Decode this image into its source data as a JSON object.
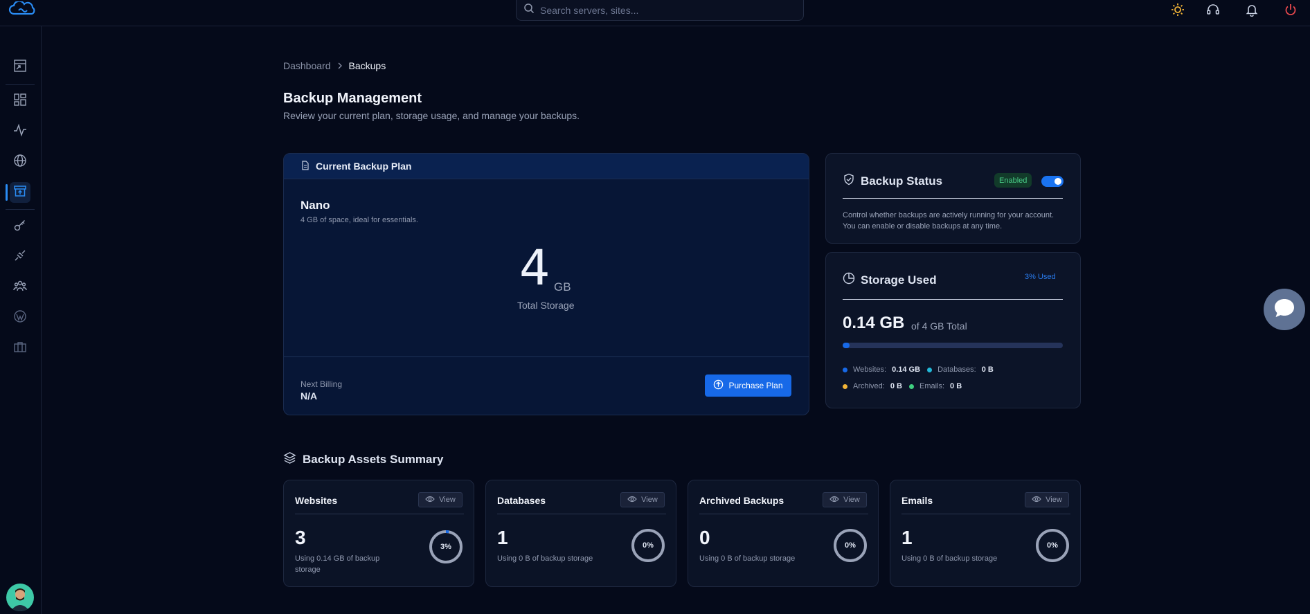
{
  "search": {
    "placeholder": "Search servers, sites..."
  },
  "breadcrumb": {
    "items": [
      "Dashboard",
      "Backups"
    ]
  },
  "page": {
    "title": "Backup Management",
    "subtitle": "Review your current plan, storage usage, and manage your backups."
  },
  "plan": {
    "header": "Current Backup Plan",
    "name": "Nano",
    "description": "4 GB of space, ideal for essentials.",
    "storage_value": "4",
    "storage_unit": "GB",
    "storage_label": "Total Storage",
    "billing_label": "Next Billing",
    "billing_value": "N/A",
    "purchase_label": "Purchase Plan"
  },
  "status": {
    "title": "Backup Status",
    "badge": "Enabled",
    "enabled": true,
    "description": "Control whether backups are actively running for your account. You can enable or disable backups at any time."
  },
  "storage": {
    "title": "Storage Used",
    "used_badge": "3% Used",
    "used_value": "0.14 GB",
    "of_total": "of 4 GB Total",
    "used_fraction": 0.03,
    "legend": [
      {
        "label": "Websites:",
        "value": "0.14 GB",
        "color": "#1769e8"
      },
      {
        "label": "Databases:",
        "value": "0 B",
        "color": "#22b8d8"
      },
      {
        "label": "Archived:",
        "value": "0 B",
        "color": "#f2b437"
      },
      {
        "label": "Emails:",
        "value": "0 B",
        "color": "#3fcf7f"
      }
    ]
  },
  "summary": {
    "title": "Backup Assets Summary",
    "view_label": "View",
    "assets": [
      {
        "name": "Websites",
        "count": "3",
        "desc": "Using 0.14 GB of backup storage",
        "percent_label": "3%",
        "percent": 0.03
      },
      {
        "name": "Databases",
        "count": "1",
        "desc": "Using 0 B of backup storage",
        "percent_label": "0%",
        "percent": 0
      },
      {
        "name": "Archived Backups",
        "count": "0",
        "desc": "Using 0 B of backup storage",
        "percent_label": "0%",
        "percent": 0
      },
      {
        "name": "Emails",
        "count": "1",
        "desc": "Using 0 B of backup storage",
        "percent_label": "0%",
        "percent": 0
      }
    ]
  },
  "colors": {
    "accent": "#1769e8",
    "success": "#4ad18a",
    "danger": "#e5484d",
    "warning": "#f2b437"
  },
  "icons": {
    "top": [
      "sun-icon",
      "headset-icon",
      "bell-icon",
      "power-icon"
    ],
    "sidebar": [
      "migrate-icon",
      "dashboard-grid-icon",
      "activity-icon",
      "globe-icon",
      "backup-archive-icon",
      "key-icon",
      "plug-icon",
      "users-icon",
      "wordpress-icon",
      "briefcase-icon"
    ]
  }
}
